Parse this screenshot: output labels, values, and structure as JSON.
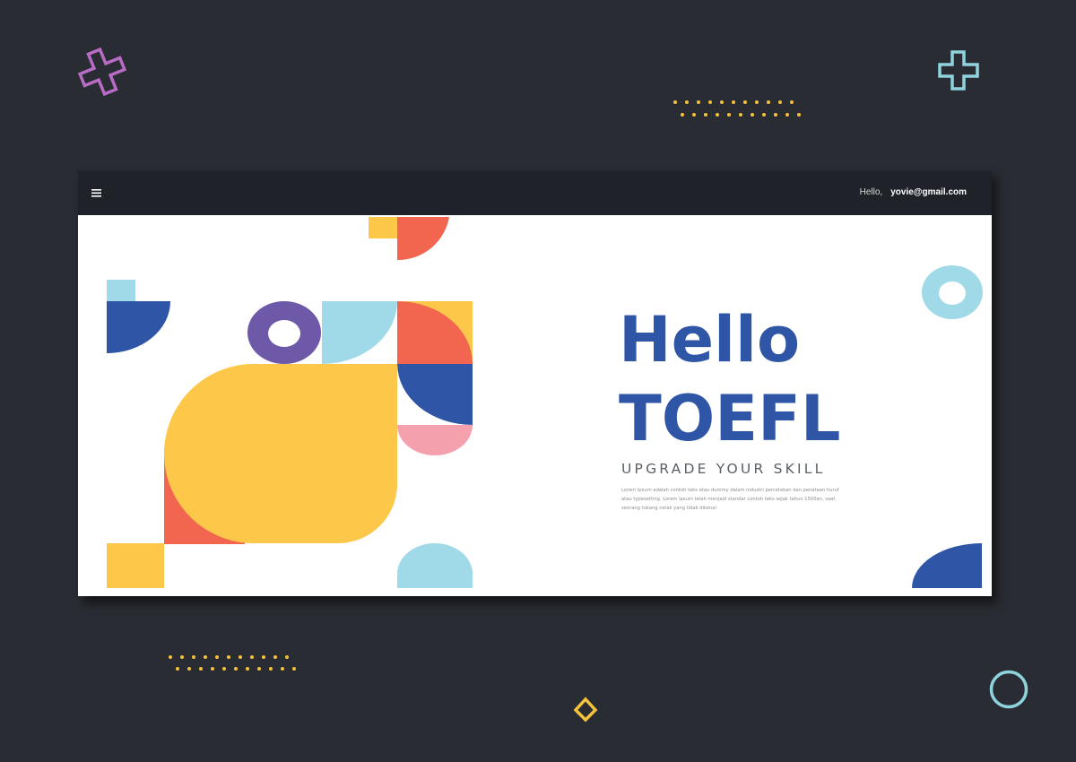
{
  "topbar": {
    "menu_icon": "hamburger-menu-icon",
    "greeting": "Hello,",
    "user_email": "yovie@gmail.com"
  },
  "hero": {
    "title_line1": "Hello",
    "title_line2": "TOEFL",
    "subtitle": "UPGRADE YOUR SKILL",
    "body": "Lorem Ipsum adalah contoh teks atau dummy dalam industri percetakan dan penataan huruf atau typesetting. Lorem Ipsum telah menjadi standar contoh teks sejak tahun 1500an, saat seorang tukang cetak yang tidak dikenal"
  },
  "colors": {
    "background": "#2a2c33",
    "topbar": "#1f2229",
    "primary_blue": "#2f55a6",
    "yellow": "#fdc84a",
    "coral": "#f26650",
    "light_blue": "#a0dae8",
    "purple": "#6e58a8",
    "pink": "#f5a0ad"
  },
  "decorations": {
    "icons": [
      "plus-outline-icon",
      "circle-outline-icon",
      "diamond-outline-icon",
      "dots-pattern"
    ]
  }
}
